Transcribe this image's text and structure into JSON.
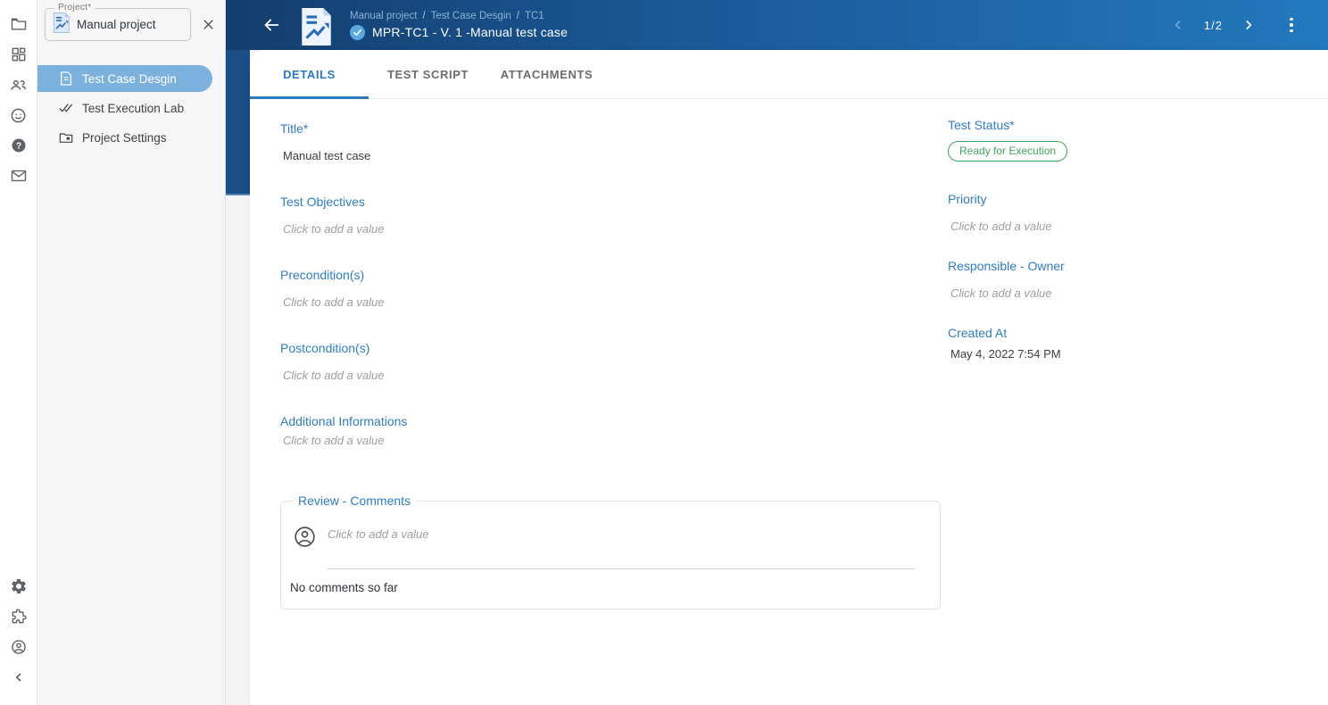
{
  "project_selector": {
    "label": "Project*",
    "value": "Manual project"
  },
  "sidebar": {
    "items": [
      {
        "label": "Test Case Desgin"
      },
      {
        "label": "Test Execution Lab"
      },
      {
        "label": "Project Settings"
      }
    ]
  },
  "header": {
    "breadcrumb": [
      "Manual project",
      "Test Case Desgin",
      "TC1"
    ],
    "separator": "/",
    "title": "MPR-TC1 - V. 1 -Manual test case",
    "pagination": "1/2"
  },
  "tabs": [
    {
      "label": "DETAILS"
    },
    {
      "label": "TEST SCRIPT"
    },
    {
      "label": "ATTACHMENTS"
    }
  ],
  "fields": {
    "title": {
      "label": "Title*",
      "value": "Manual test case"
    },
    "test_objectives": {
      "label": "Test Objectives",
      "placeholder": "Click to add a value"
    },
    "preconditions": {
      "label": "Precondition(s)",
      "placeholder": "Click to add a value"
    },
    "postconditions": {
      "label": "Postcondition(s)",
      "placeholder": "Click to add a value"
    },
    "additional_informations": {
      "label": "Additional Informations",
      "placeholder": "Click to add a value"
    },
    "test_status": {
      "label": "Test Status*",
      "value": "Ready for Execution"
    },
    "priority": {
      "label": "Priority",
      "placeholder": "Click to add a value"
    },
    "responsible_owner": {
      "label": "Responsible - Owner",
      "placeholder": "Click to add a value"
    },
    "created_at": {
      "label": "Created At",
      "value": "May 4, 2022 7:54 PM"
    }
  },
  "comments": {
    "legend": "Review - Comments",
    "placeholder": "Click to add a value",
    "empty_text": "No comments so far"
  },
  "colors": {
    "accent_blue": "#2f7dc0",
    "header_dark": "#133e6d",
    "header_light": "#2278bc",
    "selected_item": "#7cb1de",
    "status_green": "#3fa45c"
  }
}
